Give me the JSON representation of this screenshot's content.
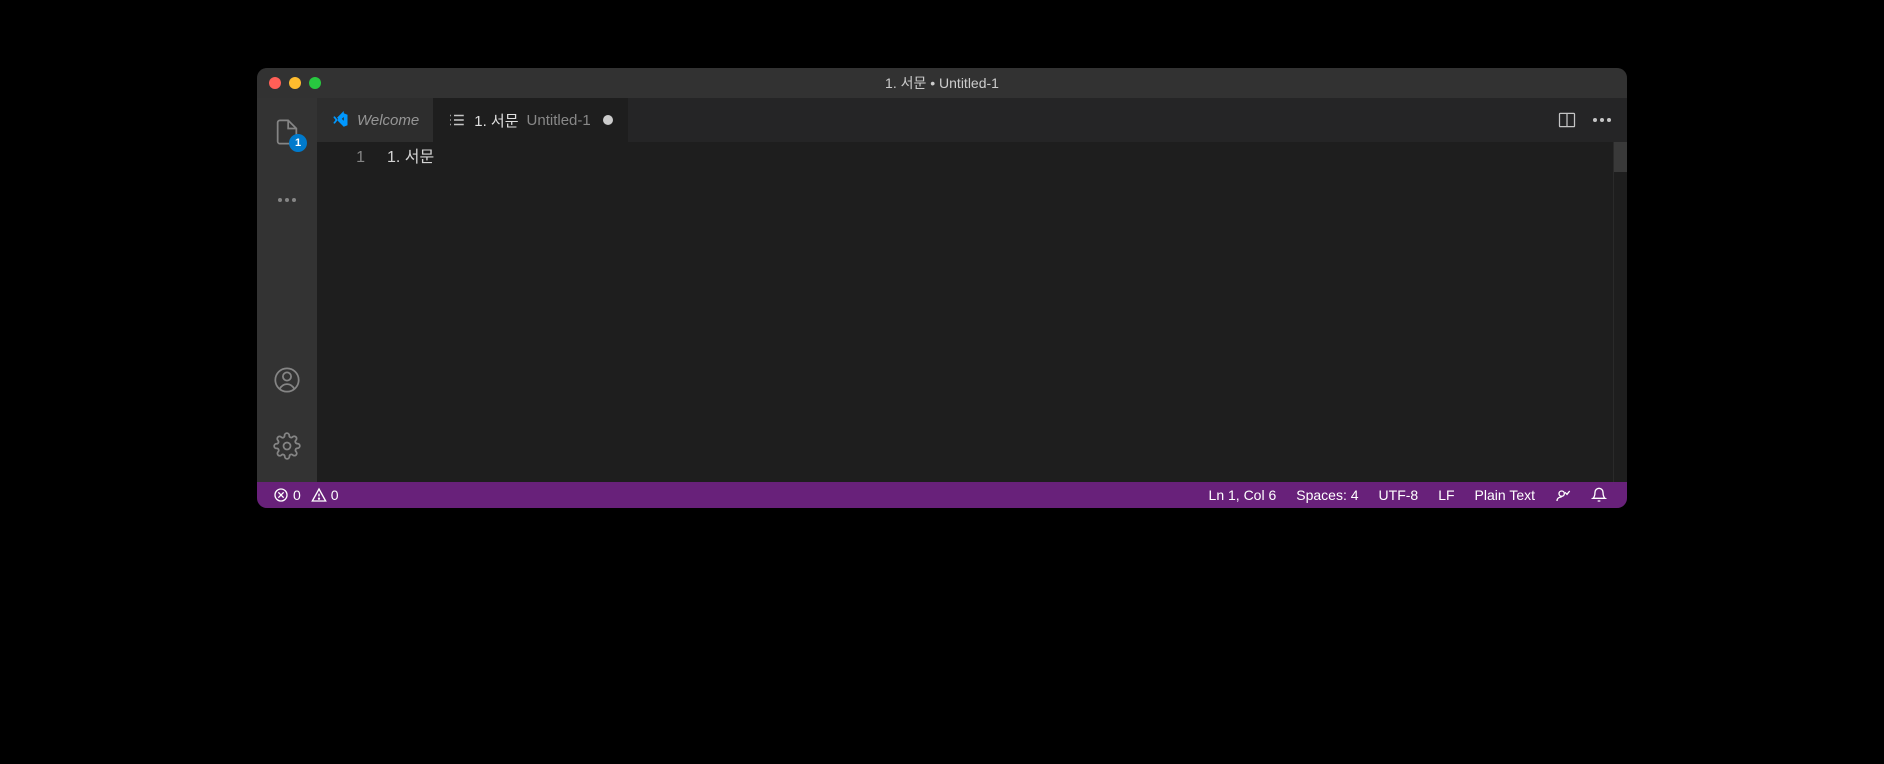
{
  "window": {
    "title": "1. 서문 • Untitled-1"
  },
  "activityBar": {
    "explorer_badge": "1"
  },
  "tabs": {
    "welcome_label": "Welcome",
    "file_title": "1. 서문",
    "file_subtitle": "Untitled-1"
  },
  "editor": {
    "line_number_1": "1",
    "line_content_1": "1. 서문"
  },
  "statusbar": {
    "errors": "0",
    "warnings": "0",
    "cursor": "Ln 1, Col 6",
    "spaces": "Spaces: 4",
    "encoding": "UTF-8",
    "eol": "LF",
    "language": "Plain Text"
  }
}
